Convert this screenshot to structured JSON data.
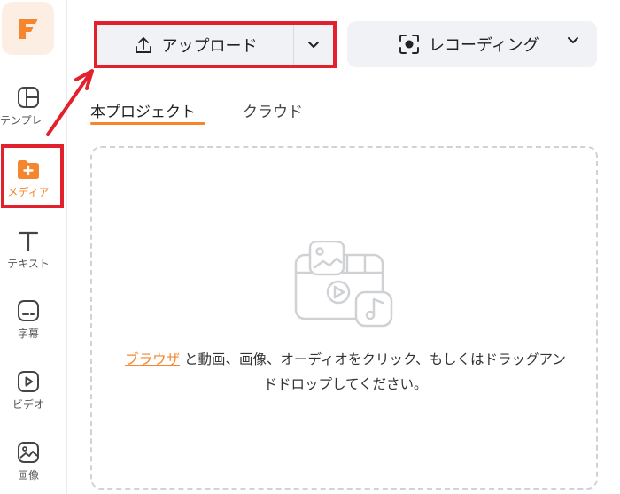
{
  "sidebar": {
    "items": [
      {
        "label": "テンプレ",
        "icon": "template-icon"
      },
      {
        "label": "メディア",
        "icon": "media-folder-icon",
        "active": true
      },
      {
        "label": "テキスト",
        "icon": "text-icon"
      },
      {
        "label": "字幕",
        "icon": "caption-icon"
      },
      {
        "label": "ビデオ",
        "icon": "video-icon"
      },
      {
        "label": "画像",
        "icon": "image-icon"
      }
    ]
  },
  "toolbar": {
    "upload_label": "アップロード",
    "record_label": "レコーディング"
  },
  "tabs": [
    {
      "label": "本プロジェクト",
      "active": true
    },
    {
      "label": "クラウド",
      "active": false
    }
  ],
  "dropzone": {
    "link_text": "ブラウザ",
    "text": " と動画、画像、オーディオをクリック、もしくはドラッグアンドドロップしてください。"
  },
  "colors": {
    "accent": "#f5862d",
    "highlight": "#e3212c",
    "button_bg": "#f1f2f5"
  }
}
